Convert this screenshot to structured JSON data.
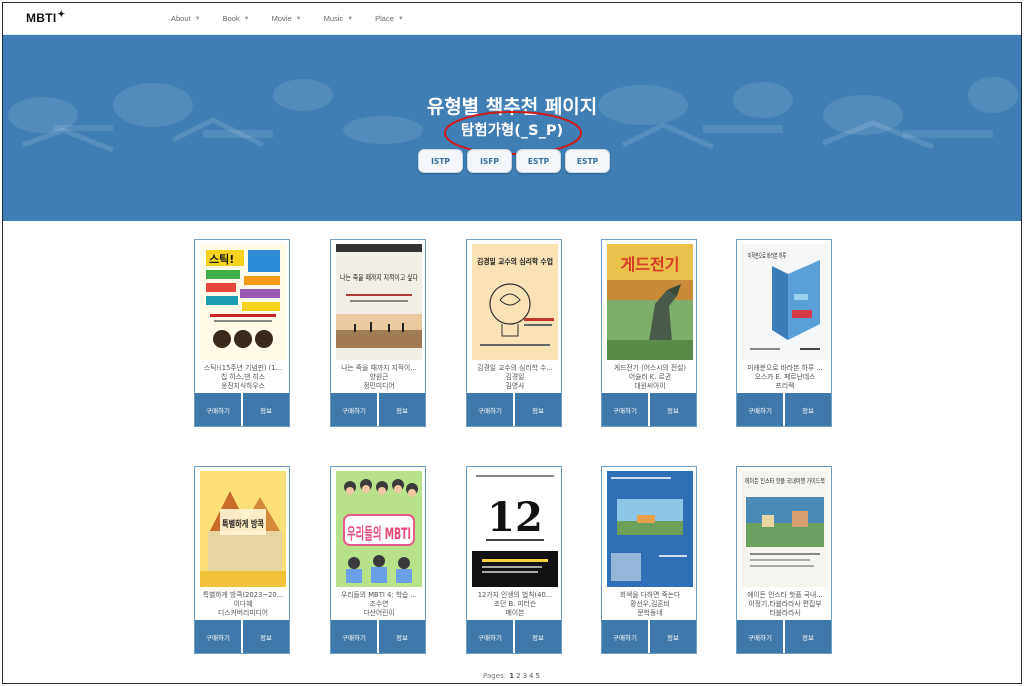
{
  "brand": {
    "logo": "MBTI",
    "spark": "✦"
  },
  "nav": {
    "items": [
      "About",
      "Book",
      "Movie",
      "Music",
      "Place"
    ]
  },
  "hero": {
    "title": "유형별 책추천 페이지",
    "subtitle": "탐험가형(_S_P)",
    "buttons": [
      "ISTP",
      "ISFP",
      "ESTP",
      "ESTP"
    ],
    "accent": "#3f7fb6",
    "annotation_color": "#d11a1a"
  },
  "card_buttons": {
    "buy": "구매하기",
    "info": "정보"
  },
  "books": [
    {
      "title": "스틱!(15주년 기념판) (1...",
      "author": "칩 히스,댄 히스",
      "publisher": "웅진지식하우스",
      "cover": "stick",
      "cover_text": "스틱!"
    },
    {
      "title": "나는 죽을 때까지 지적이...",
      "author": "양원근",
      "publisher": "정민미디어",
      "cover": "wise",
      "cover_text": "나는 죽을 때까지 지적이고 싶다"
    },
    {
      "title": "김경일 교수의 심리학 수...",
      "author": "김경일",
      "publisher": "김영사",
      "cover": "psych",
      "cover_text": "김경일 교수의 심리학 수업"
    },
    {
      "title": "게드전기 (어스시의 전설)",
      "author": "어슐러 K. 르귄",
      "publisher": "대원씨아이",
      "cover": "dragon",
      "cover_text": "게드전기"
    },
    {
      "title": "미래분으로 바라본 하루 ...",
      "author": "오스카 E. 페르난데스",
      "publisher": "프리렉",
      "cover": "math",
      "cover_text": "미적분으로 바라본 하루"
    },
    {
      "title": "특별하게 방콕(2023~20...",
      "author": "이다혜",
      "publisher": "디스커버리미디어",
      "cover": "bangkok",
      "cover_text": "특별하게 방콕"
    },
    {
      "title": "우리들의 MBTI 4: 학습 ...",
      "author": "조수연",
      "publisher": "다산어린이",
      "cover": "mbti",
      "cover_text": "우리들의 MBTI"
    },
    {
      "title": "12가지 인생의 법칙(40...",
      "author": "조던 B. 피터슨",
      "publisher": "메이븐",
      "cover": "twelve",
      "cover_text": "12"
    },
    {
      "title": "회색을 다하면 죽는다",
      "author": "황선우,김혼비",
      "publisher": "문학동네",
      "cover": "blue",
      "cover_text": ""
    },
    {
      "title": "에이든 인스타 핫플 국내...",
      "author": "이정기,타블라라사 편집부",
      "publisher": "타블라라사",
      "cover": "insta",
      "cover_text": "에이든 인스타 핫플 국내여행 가이드북"
    }
  ],
  "pagination": {
    "label": "Pages:",
    "pages": [
      "1",
      "2",
      "3",
      "4",
      "5"
    ],
    "current": "1"
  }
}
